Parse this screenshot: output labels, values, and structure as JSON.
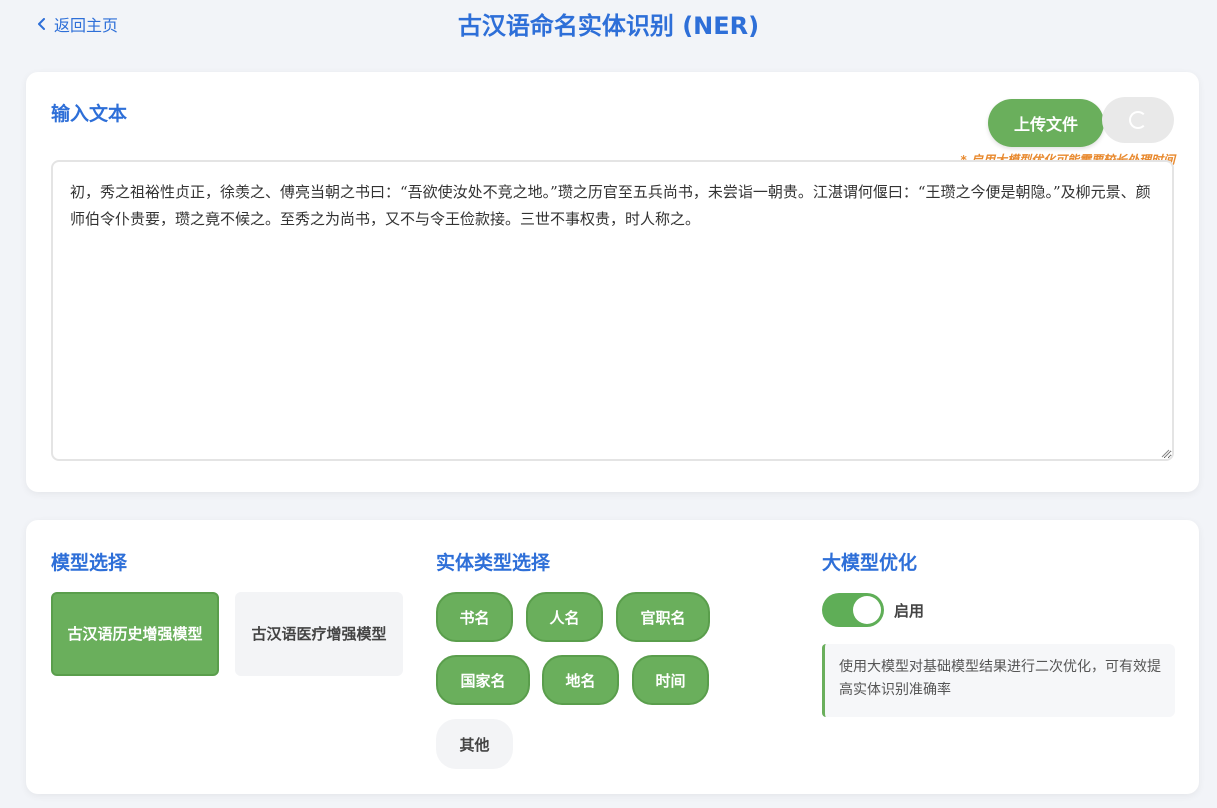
{
  "header": {
    "back_label": "返回主页",
    "title": "古汉语命名实体识别 (NER)"
  },
  "input_section": {
    "title": "输入文本",
    "upload_label": "上传文件",
    "hint": "* 启用大模型优化可能需要较长处理时间",
    "text": "初，秀之祖裕性贞正，徐羡之、傅亮当朝之书曰：“吾欲使汝处不竞之地。”瓒之历官至五兵尚书，未尝诣一朝贵。江湛谓何偃曰：“王瓒之今便是朝隐。”及柳元景、颜师伯令仆贵要，瓒之竟不候之。至秀之为尚书，又不与令王俭款接。三世不事权贵，时人称之。"
  },
  "model_section": {
    "title": "模型选择",
    "options": [
      {
        "label": "古汉语历史增强模型",
        "selected": true
      },
      {
        "label": "古汉语医疗增强模型",
        "selected": false
      }
    ]
  },
  "entity_section": {
    "title": "实体类型选择",
    "types": [
      {
        "label": "书名",
        "selected": true
      },
      {
        "label": "人名",
        "selected": true
      },
      {
        "label": "官职名",
        "selected": true
      },
      {
        "label": "国家名",
        "selected": true
      },
      {
        "label": "地名",
        "selected": true
      },
      {
        "label": "时间",
        "selected": true
      },
      {
        "label": "其他",
        "selected": false
      }
    ]
  },
  "llm_section": {
    "title": "大模型优化",
    "toggle_on": true,
    "toggle_label": "启用",
    "description": "使用大模型对基础模型结果进行二次优化，可有效提高实体识别准确率"
  },
  "colors": {
    "accent_blue": "#2e6fd8",
    "accent_green": "#6aaf5c",
    "hint_orange": "#e8892e"
  }
}
